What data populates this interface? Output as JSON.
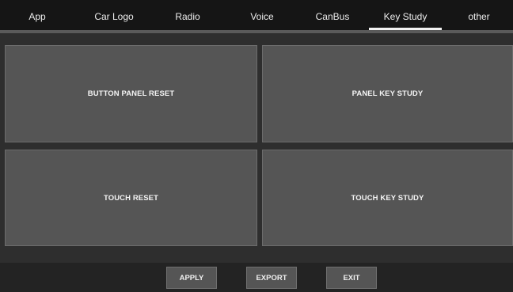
{
  "tabs": [
    {
      "label": "App"
    },
    {
      "label": "Car Logo"
    },
    {
      "label": "Radio"
    },
    {
      "label": "Voice"
    },
    {
      "label": "CanBus"
    },
    {
      "label": "Key Study",
      "active": true
    },
    {
      "label": "other"
    }
  ],
  "panels": {
    "button_panel_reset": "BUTTON PANEL RESET",
    "panel_key_study": "PANEL KEY STUDY",
    "touch_reset": "TOUCH RESET",
    "touch_key_study": "TOUCH KEY STUDY"
  },
  "footer": {
    "apply_label": "APPLY",
    "export_label": "EXPORT",
    "exit_label": "EXIT"
  }
}
